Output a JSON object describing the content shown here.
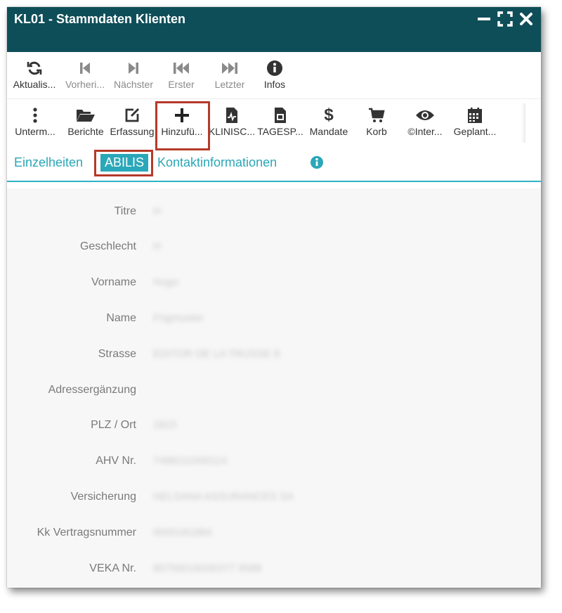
{
  "window": {
    "title": "KL01 - Stammdaten Klienten",
    "theme_color": "#0e4e58",
    "accent_color": "#2aa7b8",
    "highlight_color": "#b53a2a"
  },
  "toolbar1": {
    "items": [
      {
        "label": "Aktualis...",
        "icon": "refresh-icon",
        "enabled": true
      },
      {
        "label": "Vorheri...",
        "icon": "step-backward-icon",
        "enabled": false
      },
      {
        "label": "Nächster",
        "icon": "step-forward-icon",
        "enabled": false
      },
      {
        "label": "Erster",
        "icon": "fast-backward-icon",
        "enabled": false
      },
      {
        "label": "Letzter",
        "icon": "fast-forward-icon",
        "enabled": false
      },
      {
        "label": "Infos",
        "icon": "info-icon",
        "enabled": true
      }
    ]
  },
  "toolbar2": {
    "items": [
      {
        "label": "Unterm...",
        "icon": "more-vertical-icon"
      },
      {
        "label": "Berichte",
        "icon": "folder-open-icon"
      },
      {
        "label": "Erfassung",
        "icon": "edit-icon"
      },
      {
        "label": "Hinzufü...",
        "icon": "plus-icon"
      },
      {
        "label": "KLINISC...",
        "icon": "medical-file-icon"
      },
      {
        "label": "TAGESP...",
        "icon": "file-icon"
      },
      {
        "label": "Mandate",
        "icon": "dollar-icon"
      },
      {
        "label": "Korb",
        "icon": "cart-icon"
      },
      {
        "label": "©Inter...",
        "icon": "eye-icon"
      },
      {
        "label": "Geplant...",
        "icon": "calendar-icon"
      }
    ]
  },
  "tabs": [
    {
      "label": "Einzelheiten",
      "active": false
    },
    {
      "label": "ABILIS",
      "active": true
    },
    {
      "label": "Kontaktinformationen",
      "active": false
    }
  ],
  "fields": [
    {
      "label": "Titre",
      "value": "H"
    },
    {
      "label": "Geschlecht",
      "value": "H"
    },
    {
      "label": "Vorname",
      "value": "Hugo"
    },
    {
      "label": "Name",
      "value": "Frigmuster"
    },
    {
      "label": "Strasse",
      "value": "EDITOR DE LA TRUSSE 8"
    },
    {
      "label": "Adressergänzung",
      "value": ""
    },
    {
      "label": "PLZ / Ort",
      "value": "1815"
    },
    {
      "label": "AHV Nr.",
      "value": "7488111000114"
    },
    {
      "label": "Versicherung",
      "value": "HELSANA ASSURANCES SA"
    },
    {
      "label": "Kk Vertragsnummer",
      "value": "0000181884"
    },
    {
      "label": "VEKA Nr.",
      "value": "80756018200377 9588"
    }
  ]
}
